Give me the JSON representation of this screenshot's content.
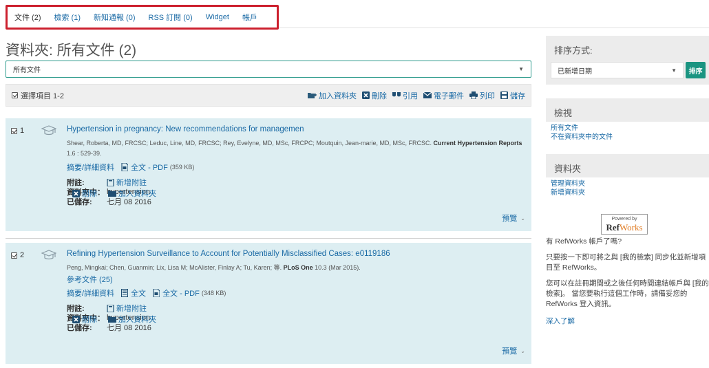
{
  "tabs": [
    {
      "label": "文件 (2)"
    },
    {
      "label": "檢索 (1)"
    },
    {
      "label": "新知通報 (0)"
    },
    {
      "label": "RSS 訂閱 (0)"
    },
    {
      "label": "Widget"
    },
    {
      "label": "帳戶"
    }
  ],
  "main": {
    "title": "資料夾: 所有文件 (2)",
    "folder_select": "所有文件",
    "select_all": "選擇項目 1-2",
    "actions": {
      "add_folder": "加入資料夾",
      "delete": "刪除",
      "cite": "引用",
      "email": "電子郵件",
      "print": "列印",
      "save": "儲存"
    }
  },
  "labels": {
    "abstract": "摘要/詳細資料",
    "fulltext": "全文",
    "fulltext_pdf": "全文 - PDF",
    "notes": "附註:",
    "add_note": "新增附註",
    "in_folder": "資料夾中：",
    "saved": "已儲存:",
    "delete": "刪除",
    "add_folder": "加入資料夾",
    "preview": "預覽"
  },
  "records": [
    {
      "number": "1",
      "title": "Hypertension in pregnancy: New recommendations for managemen",
      "authors": "Shear, Roberta, MD, FRCSC; Leduc, Line, MD, FRCSC; Rey, Evelyne, MD, MSc, FRCPC; Moutquin, Jean-marie, MD, MSc, FRCSC.",
      "journal": "Current Hypertension Reports",
      "citation": " 1.6 : 529-39.",
      "pdf_size": "(359 KB)",
      "folder": "hypertension",
      "saved_date": "七月 08 2016"
    },
    {
      "number": "2",
      "title": "Refining Hypertension Surveillance to Account for Potentially Misclassified Cases: e0119186",
      "authors": "Peng, Mingkai; Chen, Guanmin; Lix, Lisa M; McAlister, Finlay A; Tu, Karen; 等.",
      "journal": "PLoS One",
      "citation": " 10.3  (Mar 2015).",
      "references": "參考文件 (25)",
      "pdf_size": "(348 KB)",
      "folder": "hypertension",
      "saved_date": "七月 08 2016"
    }
  ],
  "sidebar": {
    "sort_heading": "排序方式:",
    "sort_value": "已新增日期",
    "sort_button": "排序",
    "view_heading": "檢視",
    "view_links": [
      "所有文件",
      "不在資料夾中的文件"
    ],
    "folder_heading": "資料夾",
    "folder_links": [
      "管理資料夾",
      "新增資料夾"
    ],
    "powered_by": "Powered by",
    "refworks_ref": "Ref",
    "refworks_works": "Works",
    "question": "有 RefWorks 帳戶了嗎?",
    "para1": "只要按一下即可將之與 [我的檢索] 同步化並新增項目至 RefWorks。",
    "para2": "您可以在註冊期間或之後任何時間連結帳戶與 [我的檢索]。 當您要執行這個工作時，請備妥您的 RefWorks 登入資訊。",
    "learn_more": "深入了解"
  }
}
